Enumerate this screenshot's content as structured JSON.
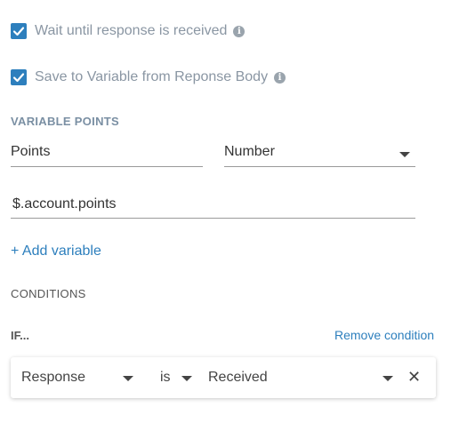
{
  "options": {
    "wait_label": "Wait until response is received",
    "save_label": "Save to Variable from Reponse Body",
    "wait_checked": true,
    "save_checked": true
  },
  "variables": {
    "section_title": "VARIABLE POINTS",
    "name_value": "Points",
    "type_value": "Number",
    "path_value": "$.account.points",
    "add_label": "+ Add variable"
  },
  "conditions": {
    "section_title": "CONDITIONS",
    "if_label": "IF...",
    "remove_label": "Remove condition",
    "subject_value": "Response",
    "operator_value": "is",
    "target_value": "Received",
    "close_glyph": "✕"
  },
  "colors": {
    "accent": "#2d7fbd",
    "muted_label": "#8a96a3"
  }
}
